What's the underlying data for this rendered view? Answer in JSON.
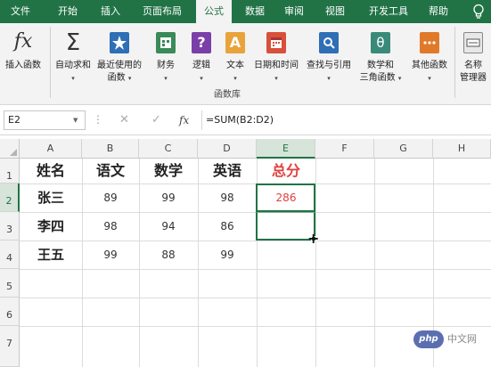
{
  "tabs": [
    "文件",
    "开始",
    "插入",
    "页面布局",
    "公式",
    "数据",
    "审阅",
    "视图",
    "开发工具",
    "帮助"
  ],
  "active_tab": "公式",
  "ribbon": {
    "insert_function": "插入函数",
    "autosum": "自动求和",
    "recent_line1": "最近使用的",
    "recent_line2": "函数",
    "financial": "财务",
    "logical": "逻辑",
    "text": "文本",
    "datetime": "日期和时间",
    "lookup": "查找与引用",
    "math_line1": "数学和",
    "math_line2": "三角函数",
    "other": "其他函数",
    "name_mgr_line1": "名称",
    "name_mgr_line2": "管理器",
    "group_label": "函数库",
    "fx_symbol": "fx",
    "sigma_symbol": "Σ",
    "logical_symbol": "?",
    "text_symbol": "A",
    "math_symbol": "θ",
    "dropdown_glyph": "▾"
  },
  "formula_bar": {
    "name_box": "E2",
    "fx_label": "fx",
    "cancel": "✕",
    "enter": "✓",
    "formula": "=SUM(B2:D2)"
  },
  "sheet": {
    "columns": [
      "A",
      "B",
      "C",
      "D",
      "E",
      "F",
      "G",
      "H"
    ],
    "rows": [
      "1",
      "2",
      "3",
      "4",
      "5",
      "6",
      "7"
    ],
    "selected_column": "E",
    "selected_row": "2",
    "header": [
      "姓名",
      "语文",
      "数学",
      "英语",
      "总分"
    ],
    "data": [
      [
        "张三",
        "89",
        "99",
        "98",
        "286"
      ],
      [
        "李四",
        "98",
        "94",
        "86",
        ""
      ],
      [
        "王五",
        "99",
        "88",
        "99",
        ""
      ]
    ]
  },
  "watermark": {
    "logo": "php",
    "text": "中文网"
  },
  "colors": {
    "accent": "#217346",
    "total_red": "#e04040"
  }
}
